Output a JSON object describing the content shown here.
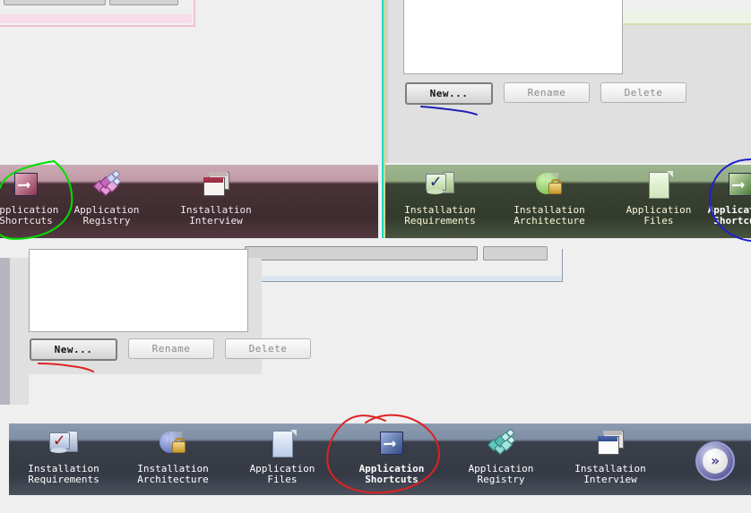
{
  "window": {
    "background_color": "#efeff0",
    "dialog_background": "#e0e0e0"
  },
  "panels": {
    "top_left_pink": {
      "border_color": "#f0c0d4",
      "buttons": [
        "",
        ""
      ]
    },
    "top_right_dialog": {
      "buttons": {
        "new_label": "New...",
        "rename_label": "Rename",
        "delete_label": "Delete"
      },
      "list_value": ""
    },
    "top_right_green_inset": {
      "border_color": "#cfe0b0",
      "field_value": ""
    },
    "bottom_left_dialog": {
      "buttons": {
        "new_label": "New...",
        "rename_label": "Rename",
        "delete_label": "Delete"
      },
      "list_value": ""
    },
    "middle_inset": {
      "field_value": ""
    }
  },
  "toolbars": {
    "pink": {
      "theme_color": "#3d2c30",
      "highlight_color": "#c09aa6",
      "items": [
        {
          "label": "Application\nShortcuts",
          "icon": "shortcut-arrow-icon",
          "selected": false
        },
        {
          "label": "Application\nRegistry",
          "icon": "registry-blocks-icon",
          "selected": false
        },
        {
          "label": "Installation\nInterview",
          "icon": "windows-icon",
          "selected": false
        }
      ],
      "next_button": {
        "icon": "chevron-double-right-icon",
        "label": "»"
      }
    },
    "green": {
      "theme_color": "#323b2c",
      "highlight_color": "#94ad85",
      "items": [
        {
          "label": "Installation\nRequirements",
          "icon": "monitor-check-icon",
          "selected": false
        },
        {
          "label": "Installation\nArchitecture",
          "icon": "pie-lock-icon",
          "selected": false
        },
        {
          "label": "Application\nFiles",
          "icon": "document-icon",
          "selected": false
        },
        {
          "label": "Application\nShortcuts",
          "icon": "shortcut-arrow-icon",
          "selected": true
        }
      ]
    },
    "blue": {
      "theme_color": "#353a45",
      "highlight_color": "#7f8fa5",
      "items": [
        {
          "label": "Installation\nRequirements",
          "icon": "monitor-check-icon",
          "selected": false
        },
        {
          "label": "Installation\nArchitecture",
          "icon": "pie-lock-icon",
          "selected": false
        },
        {
          "label": "Application\nFiles",
          "icon": "document-icon",
          "selected": false
        },
        {
          "label": "Application\nShortcuts",
          "icon": "shortcut-arrow-icon",
          "selected": true
        },
        {
          "label": "Application\nRegistry",
          "icon": "registry-blocks-icon",
          "selected": false
        },
        {
          "label": "Installation\nInterview",
          "icon": "windows-icon",
          "selected": false
        }
      ],
      "next_button": {
        "icon": "chevron-double-right-icon",
        "label": "»"
      }
    }
  },
  "annotations": [
    {
      "name": "green-circle-around-application-shortcuts",
      "color": "#00e000"
    },
    {
      "name": "blue-circle-around-application-shortcuts",
      "color": "#2020d0"
    },
    {
      "name": "red-circle-around-application-shortcuts",
      "color": "#dd2222"
    },
    {
      "name": "blue-underline-new-button",
      "color": "#2020b8"
    },
    {
      "name": "red-underline-new-button",
      "color": "#dd2222"
    }
  ]
}
